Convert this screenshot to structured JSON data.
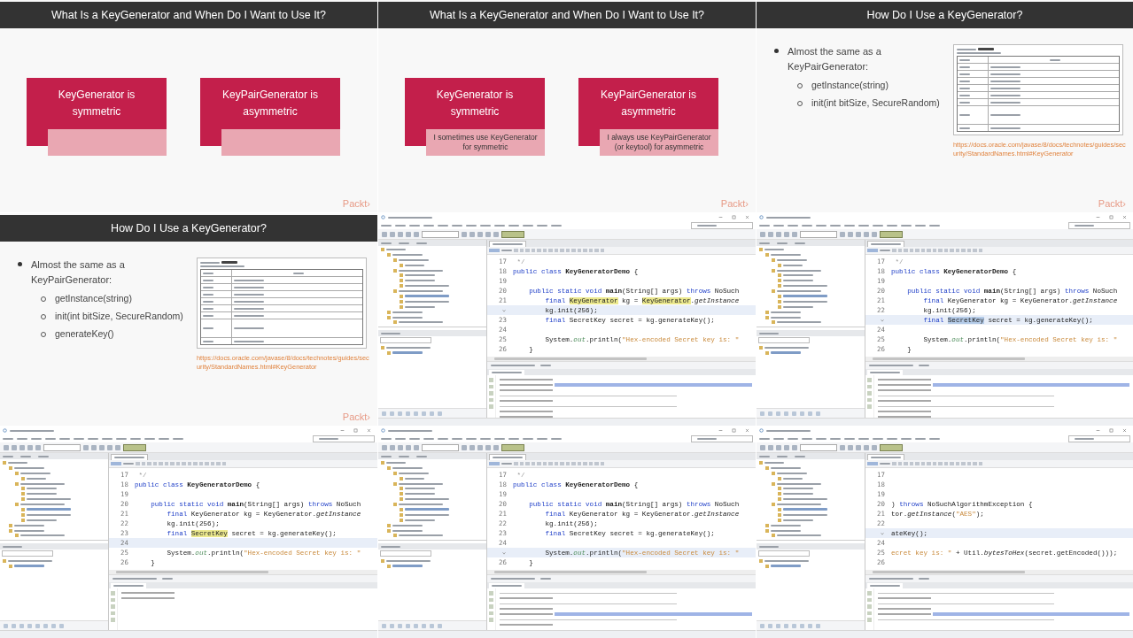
{
  "frames": [
    {
      "kind": "comparison",
      "title": "What Is a KeyGenerator and When Do I Want to Use It?",
      "boxes": [
        {
          "claim": "KeyGenerator is symmetric"
        },
        {
          "claim": "KeyPairGenerator is asymmetric"
        }
      ],
      "logo": "Packt›"
    },
    {
      "kind": "comparison",
      "title": "What Is a KeyGenerator and When Do I Want to Use It?",
      "boxes": [
        {
          "claim": "KeyGenerator is symmetric",
          "note": "I sometimes use KeyGenerator for symmetric"
        },
        {
          "claim": "KeyPairGenerator is asymmetric",
          "note": "I always use KeyPairGenerator (or keytool) for asymmetric"
        }
      ],
      "logo": "Packt›"
    },
    {
      "kind": "bullets",
      "title": "How Do I Use a KeyGenerator?",
      "bullet": "Almost the same as a KeyPairGenerator:",
      "subitems": [
        "getInstance(string)",
        "init(int bitSize, SecureRandom)"
      ],
      "link": "https://docs.oracle.com/javase/8/docs/technotes/guides/security/StandardNames.html#KeyGenerator",
      "logo": "Packt›"
    },
    {
      "kind": "bullets",
      "title": "How Do I Use a KeyGenerator?",
      "bullet": "Almost the same as a KeyPairGenerator:",
      "subitems": [
        "getInstance(string)",
        "init(int bitSize, SecureRandom)",
        "generateKey()"
      ],
      "link": "https://docs.oracle.com/javase/8/docs/technotes/guides/security/StandardNames.html#KeyGenerator",
      "logo": "Packt›"
    },
    {
      "kind": "ide",
      "ide": {
        "code": [
          {
            "number": "17",
            "current": false,
            "segments": [
              {
                "kind": "comment",
                "text": " */"
              }
            ]
          },
          {
            "number": "18",
            "current": false,
            "segments": [
              {
                "kind": "keyword",
                "text": "public class "
              },
              {
                "kind": "bold",
                "text": "KeyGeneratorDemo"
              },
              {
                "kind": "plain",
                "text": " {"
              }
            ]
          },
          {
            "number": "19",
            "current": false
          },
          {
            "number": "20",
            "current": false,
            "segments": [
              {
                "kind": "keyword",
                "text": "    public static void "
              },
              {
                "kind": "bold",
                "text": "main"
              },
              {
                "kind": "plain",
                "text": "(String[] args) "
              },
              {
                "kind": "keyword",
                "text": "throws"
              },
              {
                "kind": "plain",
                "text": " NoSuch"
              }
            ]
          },
          {
            "number": "21",
            "current": false,
            "segments": [
              {
                "kind": "keyword",
                "text": "        final "
              },
              {
                "kind": "mark",
                "text": "KeyGenerator"
              },
              {
                "kind": "plain",
                "text": " kg = "
              },
              {
                "kind": "mark",
                "text": "KeyGenerator"
              },
              {
                "kind": "plain",
                "text": "."
              },
              {
                "kind": "italic",
                "text": "getInstance"
              }
            ]
          },
          {
            "current": true,
            "segments": [
              {
                "kind": "plain",
                "text": "        kg.init(256);"
              }
            ]
          },
          {
            "number": "23",
            "current": false,
            "segments": [
              {
                "kind": "keyword",
                "text": "        final "
              },
              {
                "kind": "plain",
                "text": "SecretKey secret = kg.generateKey();"
              }
            ]
          },
          {
            "number": "24",
            "current": false
          },
          {
            "number": "25",
            "current": false,
            "segments": [
              {
                "kind": "plain",
                "text": "        System."
              },
              {
                "kind": "field",
                "text": "out"
              },
              {
                "kind": "plain",
                "text": ".println("
              },
              {
                "kind": "string",
                "text": "\"Hex-encoded Secret key is: \""
              }
            ]
          },
          {
            "number": "26",
            "current": false,
            "segments": [
              {
                "kind": "plain",
                "text": "    }"
              }
            ]
          }
        ],
        "output": [
          {
            "kind": "text",
            "selected": false
          },
          {
            "kind": "text",
            "selected": true
          },
          {
            "kind": "text",
            "selected": false
          },
          {
            "kind": "rule"
          },
          {
            "kind": "text",
            "selected": false
          },
          {
            "kind": "rule"
          },
          {
            "kind": "text",
            "selected": false
          },
          {
            "kind": "text",
            "selected": false
          }
        ]
      }
    },
    {
      "kind": "ide",
      "ide": {
        "code": [
          {
            "number": "17",
            "current": false,
            "segments": [
              {
                "kind": "comment",
                "text": " */"
              }
            ]
          },
          {
            "number": "18",
            "current": false,
            "segments": [
              {
                "kind": "keyword",
                "text": "public class "
              },
              {
                "kind": "bold",
                "text": "KeyGeneratorDemo"
              },
              {
                "kind": "plain",
                "text": " {"
              }
            ]
          },
          {
            "number": "19",
            "current": false
          },
          {
            "number": "20",
            "current": false,
            "segments": [
              {
                "kind": "keyword",
                "text": "    public static void "
              },
              {
                "kind": "bold",
                "text": "main"
              },
              {
                "kind": "plain",
                "text": "(String[] args) "
              },
              {
                "kind": "keyword",
                "text": "throws"
              },
              {
                "kind": "plain",
                "text": " NoSuch"
              }
            ]
          },
          {
            "number": "21",
            "current": false,
            "segments": [
              {
                "kind": "keyword",
                "text": "        final "
              },
              {
                "kind": "plain",
                "text": "KeyGenerator kg = KeyGenerator."
              },
              {
                "kind": "italic",
                "text": "getInstance"
              }
            ]
          },
          {
            "number": "22",
            "current": false,
            "segments": [
              {
                "kind": "plain",
                "text": "        kg.init(256);"
              }
            ]
          },
          {
            "current": true,
            "segments": [
              {
                "kind": "keyword",
                "text": "        final "
              },
              {
                "kind": "selected",
                "text": "SecretKey"
              },
              {
                "kind": "plain",
                "text": " secret = kg.generateKey();"
              }
            ]
          },
          {
            "number": "24",
            "current": false
          },
          {
            "number": "25",
            "current": false,
            "segments": [
              {
                "kind": "plain",
                "text": "        System."
              },
              {
                "kind": "field",
                "text": "out"
              },
              {
                "kind": "plain",
                "text": ".println("
              },
              {
                "kind": "string",
                "text": "\"Hex-encoded Secret key is: \""
              }
            ]
          },
          {
            "number": "26",
            "current": false,
            "segments": [
              {
                "kind": "plain",
                "text": "    }"
              }
            ]
          }
        ],
        "output": [
          {
            "kind": "text",
            "selected": false
          },
          {
            "kind": "text",
            "selected": true
          },
          {
            "kind": "text",
            "selected": false
          },
          {
            "kind": "rule"
          },
          {
            "kind": "text",
            "selected": false
          },
          {
            "kind": "rule"
          },
          {
            "kind": "text",
            "selected": false
          },
          {
            "kind": "text",
            "selected": false
          }
        ]
      }
    },
    {
      "kind": "ide",
      "ide": {
        "code": [
          {
            "number": "17",
            "current": false,
            "segments": [
              {
                "kind": "comment",
                "text": " */"
              }
            ]
          },
          {
            "number": "18",
            "current": false,
            "segments": [
              {
                "kind": "keyword",
                "text": "public class "
              },
              {
                "kind": "bold",
                "text": "KeyGeneratorDemo"
              },
              {
                "kind": "plain",
                "text": " {"
              }
            ]
          },
          {
            "number": "19",
            "current": false
          },
          {
            "number": "20",
            "current": false,
            "segments": [
              {
                "kind": "keyword",
                "text": "    public static void "
              },
              {
                "kind": "bold",
                "text": "main"
              },
              {
                "kind": "plain",
                "text": "(String[] args) "
              },
              {
                "kind": "keyword",
                "text": "throws"
              },
              {
                "kind": "plain",
                "text": " NoSuch"
              }
            ]
          },
          {
            "number": "21",
            "current": false,
            "segments": [
              {
                "kind": "keyword",
                "text": "        final "
              },
              {
                "kind": "plain",
                "text": "KeyGenerator kg = KeyGenerator."
              },
              {
                "kind": "italic",
                "text": "getInstance"
              }
            ]
          },
          {
            "number": "22",
            "current": false,
            "segments": [
              {
                "kind": "plain",
                "text": "        kg.init(256);"
              }
            ]
          },
          {
            "number": "23",
            "current": false,
            "segments": [
              {
                "kind": "keyword",
                "text": "        final "
              },
              {
                "kind": "mark",
                "text": "SecretKey"
              },
              {
                "kind": "plain",
                "text": " secret = kg.generateKey();"
              }
            ]
          },
          {
            "number": "24",
            "current": true
          },
          {
            "number": "25",
            "current": false,
            "segments": [
              {
                "kind": "plain",
                "text": "        System."
              },
              {
                "kind": "field",
                "text": "out"
              },
              {
                "kind": "plain",
                "text": ".println("
              },
              {
                "kind": "string",
                "text": "\"Hex-encoded Secret key is: \""
              }
            ]
          },
          {
            "number": "26",
            "current": false,
            "segments": [
              {
                "kind": "plain",
                "text": "    }"
              }
            ]
          }
        ],
        "output": [
          {
            "kind": "text",
            "selected": false
          },
          {
            "kind": "text",
            "selected": false
          }
        ]
      }
    },
    {
      "kind": "ide",
      "ide": {
        "code": [
          {
            "number": "17",
            "current": false,
            "segments": [
              {
                "kind": "comment",
                "text": " */"
              }
            ]
          },
          {
            "number": "18",
            "current": false,
            "segments": [
              {
                "kind": "keyword",
                "text": "public class "
              },
              {
                "kind": "bold",
                "text": "KeyGeneratorDemo"
              },
              {
                "kind": "plain",
                "text": " {"
              }
            ]
          },
          {
            "number": "19",
            "current": false
          },
          {
            "number": "20",
            "current": false,
            "segments": [
              {
                "kind": "keyword",
                "text": "    public static void "
              },
              {
                "kind": "bold",
                "text": "main"
              },
              {
                "kind": "plain",
                "text": "(String[] args) "
              },
              {
                "kind": "keyword",
                "text": "throws"
              },
              {
                "kind": "plain",
                "text": " NoSuch"
              }
            ]
          },
          {
            "number": "21",
            "current": false,
            "segments": [
              {
                "kind": "keyword",
                "text": "        final "
              },
              {
                "kind": "plain",
                "text": "KeyGenerator kg = KeyGenerator."
              },
              {
                "kind": "italic",
                "text": "getInstance"
              }
            ]
          },
          {
            "number": "22",
            "current": false,
            "segments": [
              {
                "kind": "plain",
                "text": "        kg.init(256);"
              }
            ]
          },
          {
            "number": "23",
            "current": false,
            "segments": [
              {
                "kind": "keyword",
                "text": "        final "
              },
              {
                "kind": "plain",
                "text": "SecretKey secret = kg.generateKey();"
              }
            ]
          },
          {
            "number": "24",
            "current": false
          },
          {
            "current": true,
            "segments": [
              {
                "kind": "plain",
                "text": "        System."
              },
              {
                "kind": "field",
                "text": "out"
              },
              {
                "kind": "plain",
                "text": ".println("
              },
              {
                "kind": "string",
                "text": "\"Hex-encoded Secret key is: \""
              }
            ]
          },
          {
            "number": "26",
            "current": false,
            "segments": [
              {
                "kind": "plain",
                "text": "    }"
              }
            ]
          }
        ],
        "output": [
          {
            "kind": "rule"
          },
          {
            "kind": "text",
            "selected": false
          },
          {
            "kind": "rule"
          },
          {
            "kind": "text",
            "selected": false
          },
          {
            "kind": "text",
            "selected": true
          },
          {
            "kind": "rule"
          },
          {
            "kind": "text",
            "selected": false
          }
        ]
      }
    },
    {
      "kind": "ide",
      "ide": {
        "code": [
          {
            "number": "17",
            "current": false
          },
          {
            "number": "18",
            "current": false
          },
          {
            "number": "19",
            "current": false
          },
          {
            "number": "20",
            "current": false,
            "segments": [
              {
                "kind": "plain",
                "text": ") "
              },
              {
                "kind": "keyword",
                "text": "throws"
              },
              {
                "kind": "plain",
                "text": " NoSuchAlgorithmException {"
              }
            ]
          },
          {
            "number": "21",
            "current": false,
            "segments": [
              {
                "kind": "plain",
                "text": "tor."
              },
              {
                "kind": "italic",
                "text": "getInstance"
              },
              {
                "kind": "plain",
                "text": "("
              },
              {
                "kind": "string",
                "text": "\"AES\""
              },
              {
                "kind": "plain",
                "text": ");"
              }
            ]
          },
          {
            "number": "22",
            "current": false
          },
          {
            "current": true,
            "segments": [
              {
                "kind": "plain",
                "text": "ateKey();"
              }
            ]
          },
          {
            "number": "24",
            "current": false
          },
          {
            "number": "25",
            "current": false,
            "segments": [
              {
                "kind": "string",
                "text": "ecret key is: \""
              },
              {
                "kind": "plain",
                "text": " + Util."
              },
              {
                "kind": "italic",
                "text": "bytesToHex"
              },
              {
                "kind": "plain",
                "text": "(secret.getEncoded()));"
              }
            ]
          },
          {
            "number": "26",
            "current": false
          }
        ],
        "output": [
          {
            "kind": "rule"
          },
          {
            "kind": "text",
            "selected": false
          },
          {
            "kind": "rule"
          },
          {
            "kind": "text",
            "selected": false
          },
          {
            "kind": "text",
            "selected": true
          },
          {
            "kind": "rule"
          }
        ]
      }
    }
  ]
}
